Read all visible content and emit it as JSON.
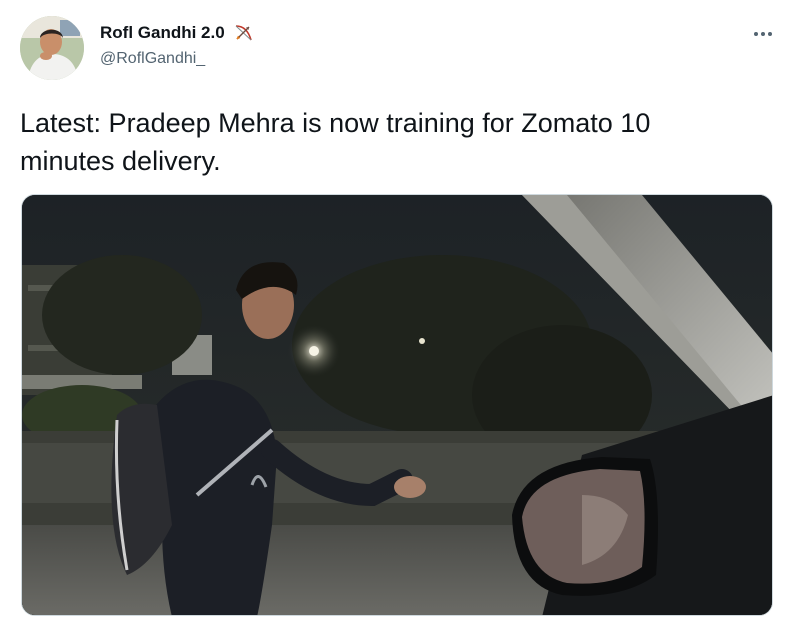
{
  "tweet": {
    "author": {
      "display_name": "Rofl Gandhi 2.0",
      "handle": "@RoflGandhi_",
      "badge_icon": "bow-and-arrow-icon"
    },
    "text": "Latest: Pradeep Mehra is now training for Zomato 10\nminutes delivery.",
    "more_icon": "more-options-icon",
    "media": {
      "type": "photo"
    }
  }
}
